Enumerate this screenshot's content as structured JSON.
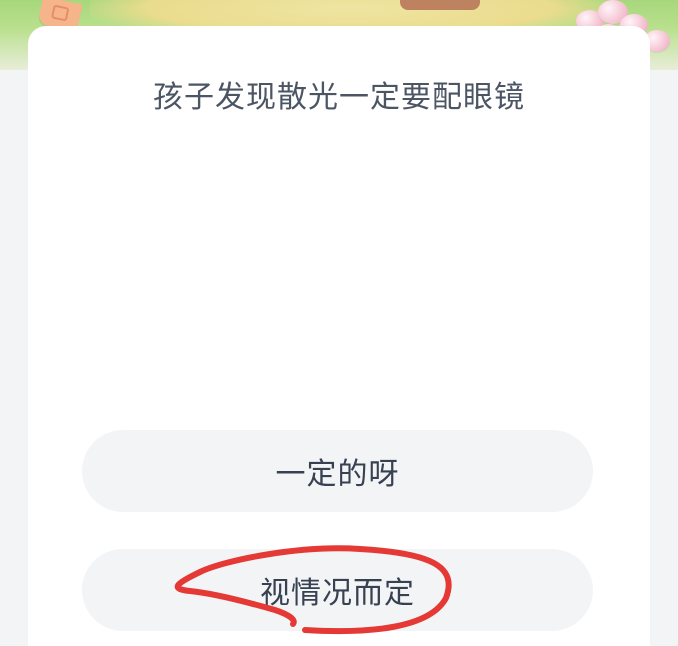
{
  "question": {
    "text": "孩子发现散光一定要配眼镜"
  },
  "options": [
    {
      "label": "一定的呀"
    },
    {
      "label": "视情况而定"
    }
  ],
  "colors": {
    "card": "#ffffff",
    "option_bg": "#f3f4f6",
    "question_text": "#4b5563",
    "option_text": "#374151",
    "annotation_red": "#e53935"
  },
  "icons": {
    "banner_decoration": "spring-garden-illustration"
  }
}
